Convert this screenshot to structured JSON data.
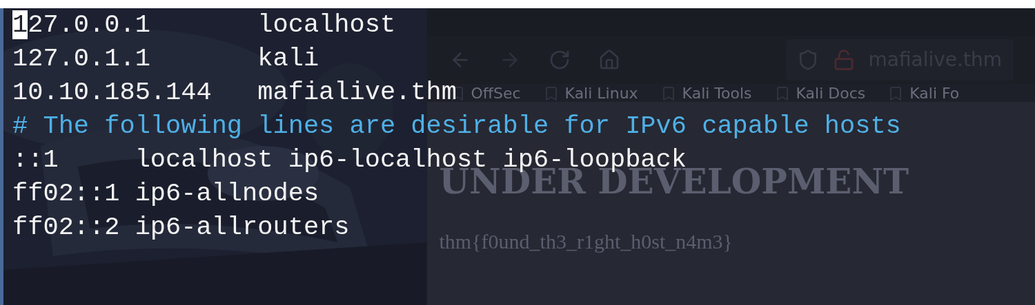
{
  "terminal": {
    "lines": [
      {
        "kind": "entry",
        "text": "127.0.0.1       localhost",
        "cursor": true
      },
      {
        "kind": "entry",
        "text": "127.0.1.1       kali",
        "cursor": false
      },
      {
        "kind": "entry",
        "text": "10.10.185.144   mafialive.thm",
        "cursor": false
      },
      {
        "kind": "comment",
        "text": "# The following lines are desirable for IPv6 capable hosts",
        "cursor": false
      },
      {
        "kind": "entry",
        "text": "::1     localhost ip6-localhost ip6-loopback",
        "cursor": false
      },
      {
        "kind": "entry",
        "text": "ff02::1 ip6-allnodes",
        "cursor": false
      },
      {
        "kind": "entry",
        "text": "ff02::2 ip6-allrouters",
        "cursor": false
      }
    ]
  },
  "browser": {
    "url": "mafialive.thm",
    "bookmarks": [
      "OffSec",
      "Kali Linux",
      "Kali Tools",
      "Kali Docs",
      "Kali Fo"
    ],
    "page": {
      "heading": "UNDER DEVELOPMENT",
      "flag": "thm{f0und_th3_r1ght_h0st_n4m3}"
    }
  }
}
